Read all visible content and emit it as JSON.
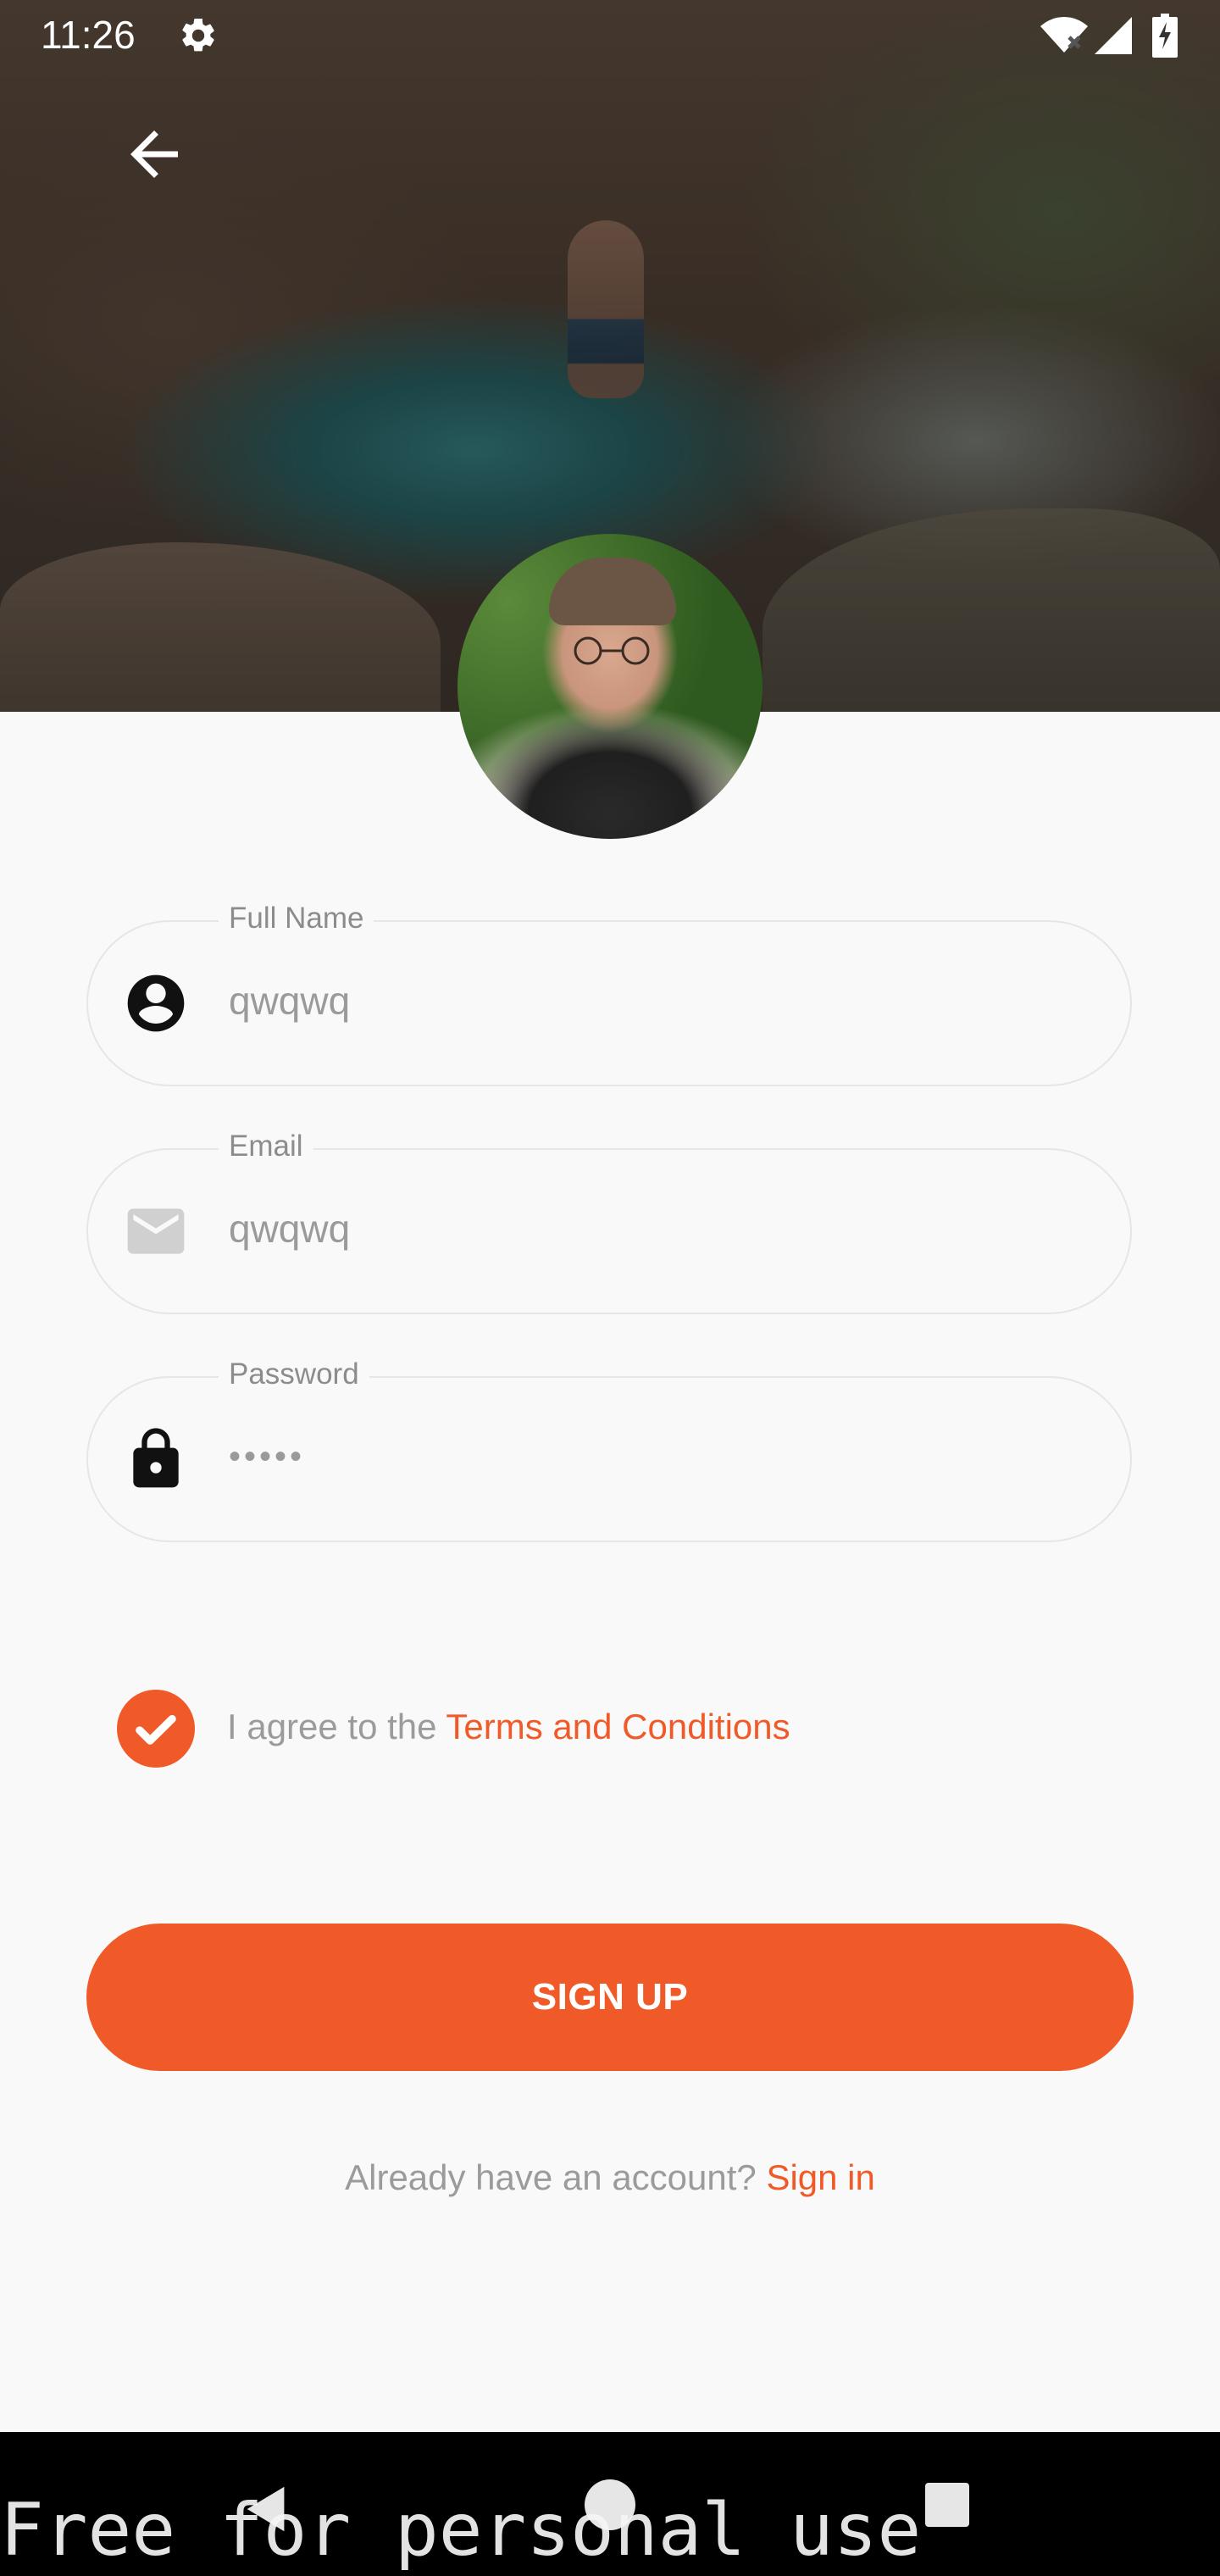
{
  "status_bar": {
    "time": "11:26",
    "icons": [
      "settings-gear-icon",
      "wifi-icon",
      "signal-icon",
      "battery-charging-icon"
    ]
  },
  "header": {
    "back_icon": "arrow-left-icon"
  },
  "form": {
    "full_name": {
      "label": "Full Name",
      "value": "qwqwq",
      "icon": "account-circle-icon"
    },
    "email": {
      "label": "Email",
      "value": "qwqwq",
      "icon": "mail-icon"
    },
    "password": {
      "label": "Password",
      "value": "•••••",
      "icon": "lock-icon"
    }
  },
  "terms": {
    "checked": true,
    "prefix": "I agree to the ",
    "link": "Terms and Conditions"
  },
  "signup_label": "SIGN UP",
  "signin": {
    "prompt": "Already have an account? ",
    "link": "Sign in"
  },
  "watermark": "Free for personal use",
  "colors": {
    "accent": "#f05a28",
    "background": "#f9f9f9",
    "muted_text": "#9b9b9b"
  }
}
